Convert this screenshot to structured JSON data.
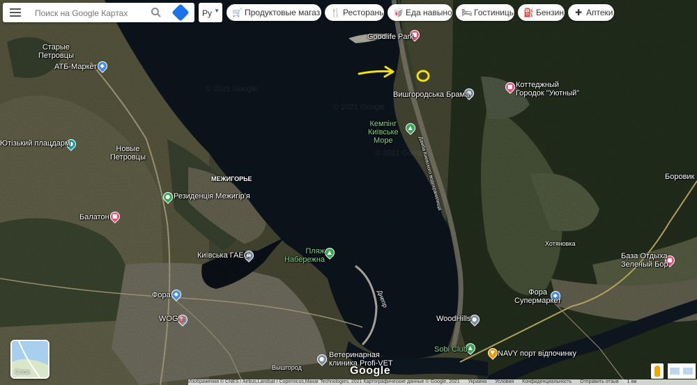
{
  "search": {
    "placeholder": "Поиск на Google Картах"
  },
  "language": {
    "value": "Ру"
  },
  "chips": [
    {
      "label": "Продуктовые магаз...",
      "icon": "cart-icon"
    },
    {
      "label": "Рестораны",
      "icon": "fork-knife-icon"
    },
    {
      "label": "Еда навынос",
      "icon": "takeout-icon"
    },
    {
      "label": "Гостиницы",
      "icon": "bed-icon"
    },
    {
      "label": "Бензин",
      "icon": "fuel-icon"
    },
    {
      "label": "Аптеки",
      "icon": "pharmacy-icon"
    }
  ],
  "layers": {
    "label": "Слои"
  },
  "map": {
    "places": {
      "stari_petrovtsi": "Старые\nПетровцы",
      "atb": "АТБ-Маркет",
      "yutizky": "Ютізький плацдарм",
      "novi_petrovtsi": "Новые\nПетровцы",
      "mezhyhorye": "МЕЖИГОРЬЕ",
      "rezydentsiya": "Резиденція Межигір'я",
      "balaton": "Балатон",
      "kyiv_gaes": "Київська ГАЕС",
      "plyazh": "Пляж\nНабережна",
      "fora_left": "Фора",
      "wog": "WOG",
      "vyshhorod": "Вышгород",
      "vet": "Ветеринарная\nклиника Profi-VET",
      "goodlife": "Goodlife Park",
      "brama": "Вишгородська Брама",
      "kemping": "Кемпінг\nКиївське\nМоре",
      "kotedzh": "Коттеджный\nГородок \"Уютный\"",
      "borovyk": "Боровик",
      "khotyanovka": "Хотяновка",
      "baza": "База Отдыха\nЗеленый Бор",
      "fora_right": "Фора\nСупермаркет",
      "woodhills": "WoodHills",
      "sobi": "Sobi Club",
      "navy": "NAVY порт відпочинку",
      "dnepr": "Днепр",
      "damba": "Дамба Киевского водохранилища"
    },
    "watermarks": [
      "© 2021 Google",
      "© 2021 Google",
      "© 2021 Google"
    ],
    "colors": {
      "water": "#0d1620",
      "forest": "#2c3a25",
      "field": "#6b6a4d",
      "annotation": "#f5e400"
    }
  },
  "google_logo": "Google",
  "footer": {
    "attribution": "Изображения © CNES / Airbus,Landsat / Copernicus,Maxar Technologies, 2021 Картографические данные © Google, 2021",
    "links": [
      "Украина",
      "Условия",
      "Конфиденциальность",
      "Отправить отзыв"
    ],
    "scale": "1 км"
  }
}
